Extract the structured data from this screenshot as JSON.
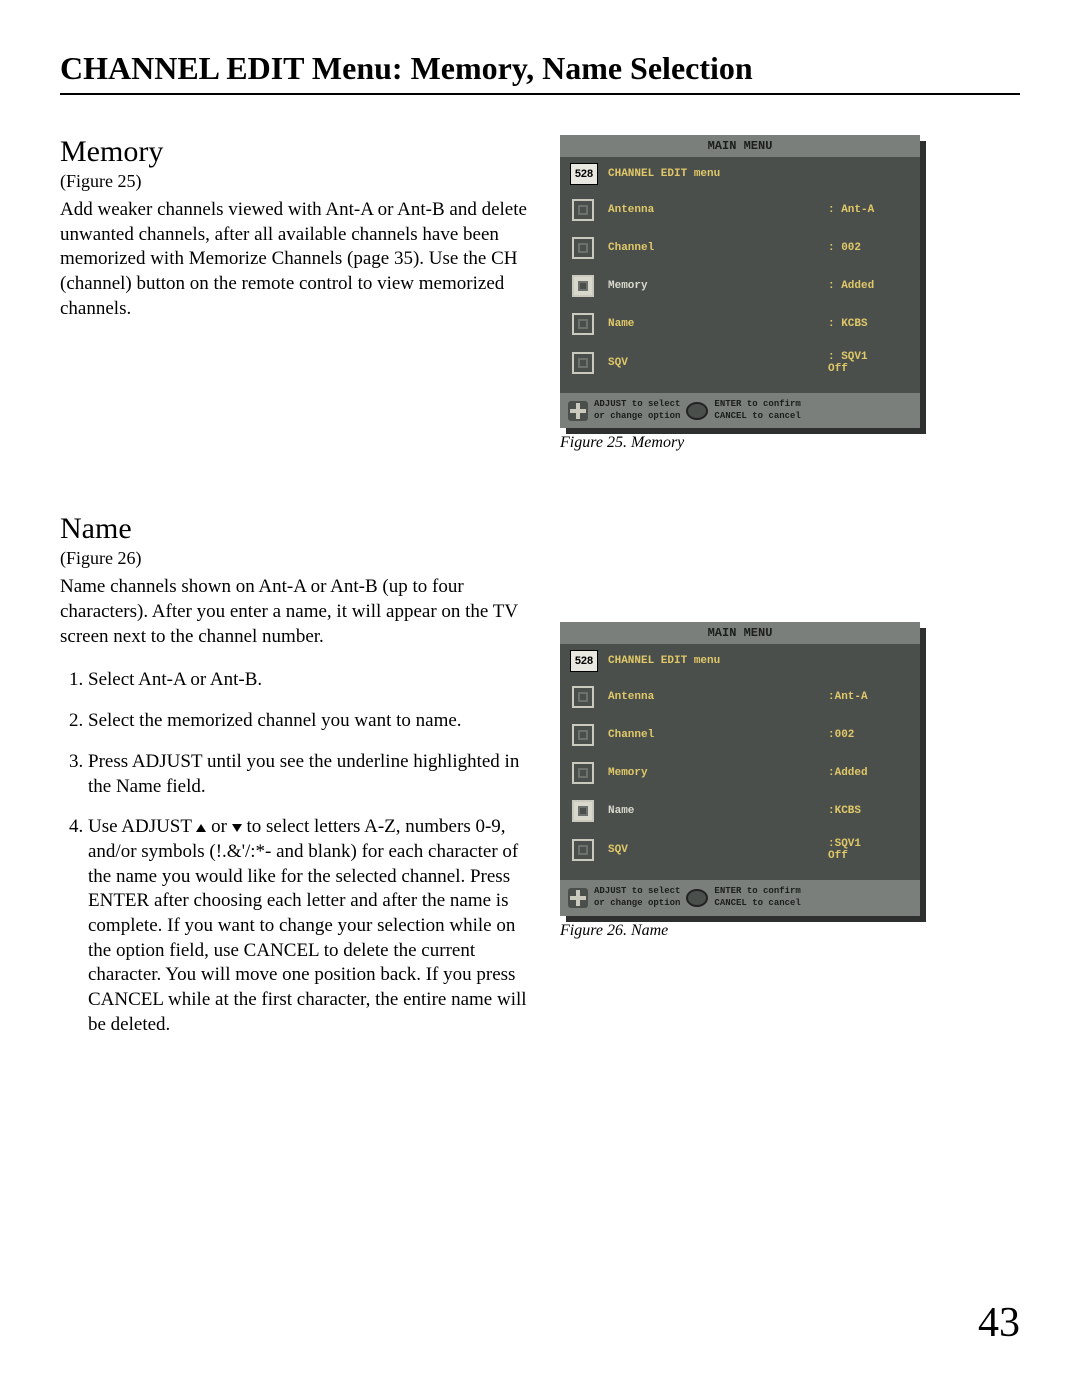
{
  "pageTitle": "CHANNEL EDIT Menu: Memory, Name Selection",
  "pageNumber": "43",
  "sections": {
    "memory": {
      "heading": "Memory",
      "figRef": "(Figure 25)",
      "body": "Add weaker channels viewed with Ant-A or Ant-B and delete unwanted channels, after all available channels have been memorized with Memorize Channels (page 35).  Use the CH (channel) button on the remote control to view memorized channels.",
      "caption": "Figure 25.  Memory"
    },
    "name": {
      "heading": "Name",
      "figRef": "(Figure 26)",
      "body": "Name channels shown on Ant-A or Ant-B (up to four characters).  After you enter a name, it will appear on the TV screen next to the channel number.",
      "steps": {
        "s1": "Select Ant-A or Ant-B.",
        "s2": "Select the memorized channel you want to name.",
        "s3": "Press ADJUST until you see the underline highlighted in the Name field.",
        "s4a": "Use ADJUST ",
        "s4b": " or ",
        "s4c": " to select letters A-Z, numbers 0-9, and/or symbols (!.&'/:*- and blank) for each character of the name you would like for the selected channel.  Press ENTER after choosing each letter and after the name is complete. If you want to change your selection while on the option field, use CANCEL to delete the current character.  You will move one position back.  If you press CANCEL while at the first character, the entire name will be deleted."
      },
      "caption": "Figure 26.  Name"
    }
  },
  "menu": {
    "header": "MAIN MENU",
    "title": "CHANNEL EDIT menu",
    "icon": "528",
    "rows": {
      "antenna": {
        "label": "Antenna",
        "value1": ": Ant-A",
        "value2": ":Ant-A"
      },
      "channel": {
        "label": "Channel",
        "value1": ": 002",
        "value2": ":002"
      },
      "memory": {
        "label": "Memory",
        "value1": ": Added",
        "value2": ":Added"
      },
      "name": {
        "label": "Name",
        "value1": ": KCBS",
        "value2": ":KCBS"
      },
      "sqv": {
        "label": "SQV",
        "value1": ": SQV1",
        "value2": ":SQV1",
        "sub": "Off"
      }
    },
    "footer": {
      "l1": "ADJUST to select",
      "l2": "or change option",
      "r1": "ENTER to confirm",
      "r2": "CANCEL to cancel"
    }
  }
}
